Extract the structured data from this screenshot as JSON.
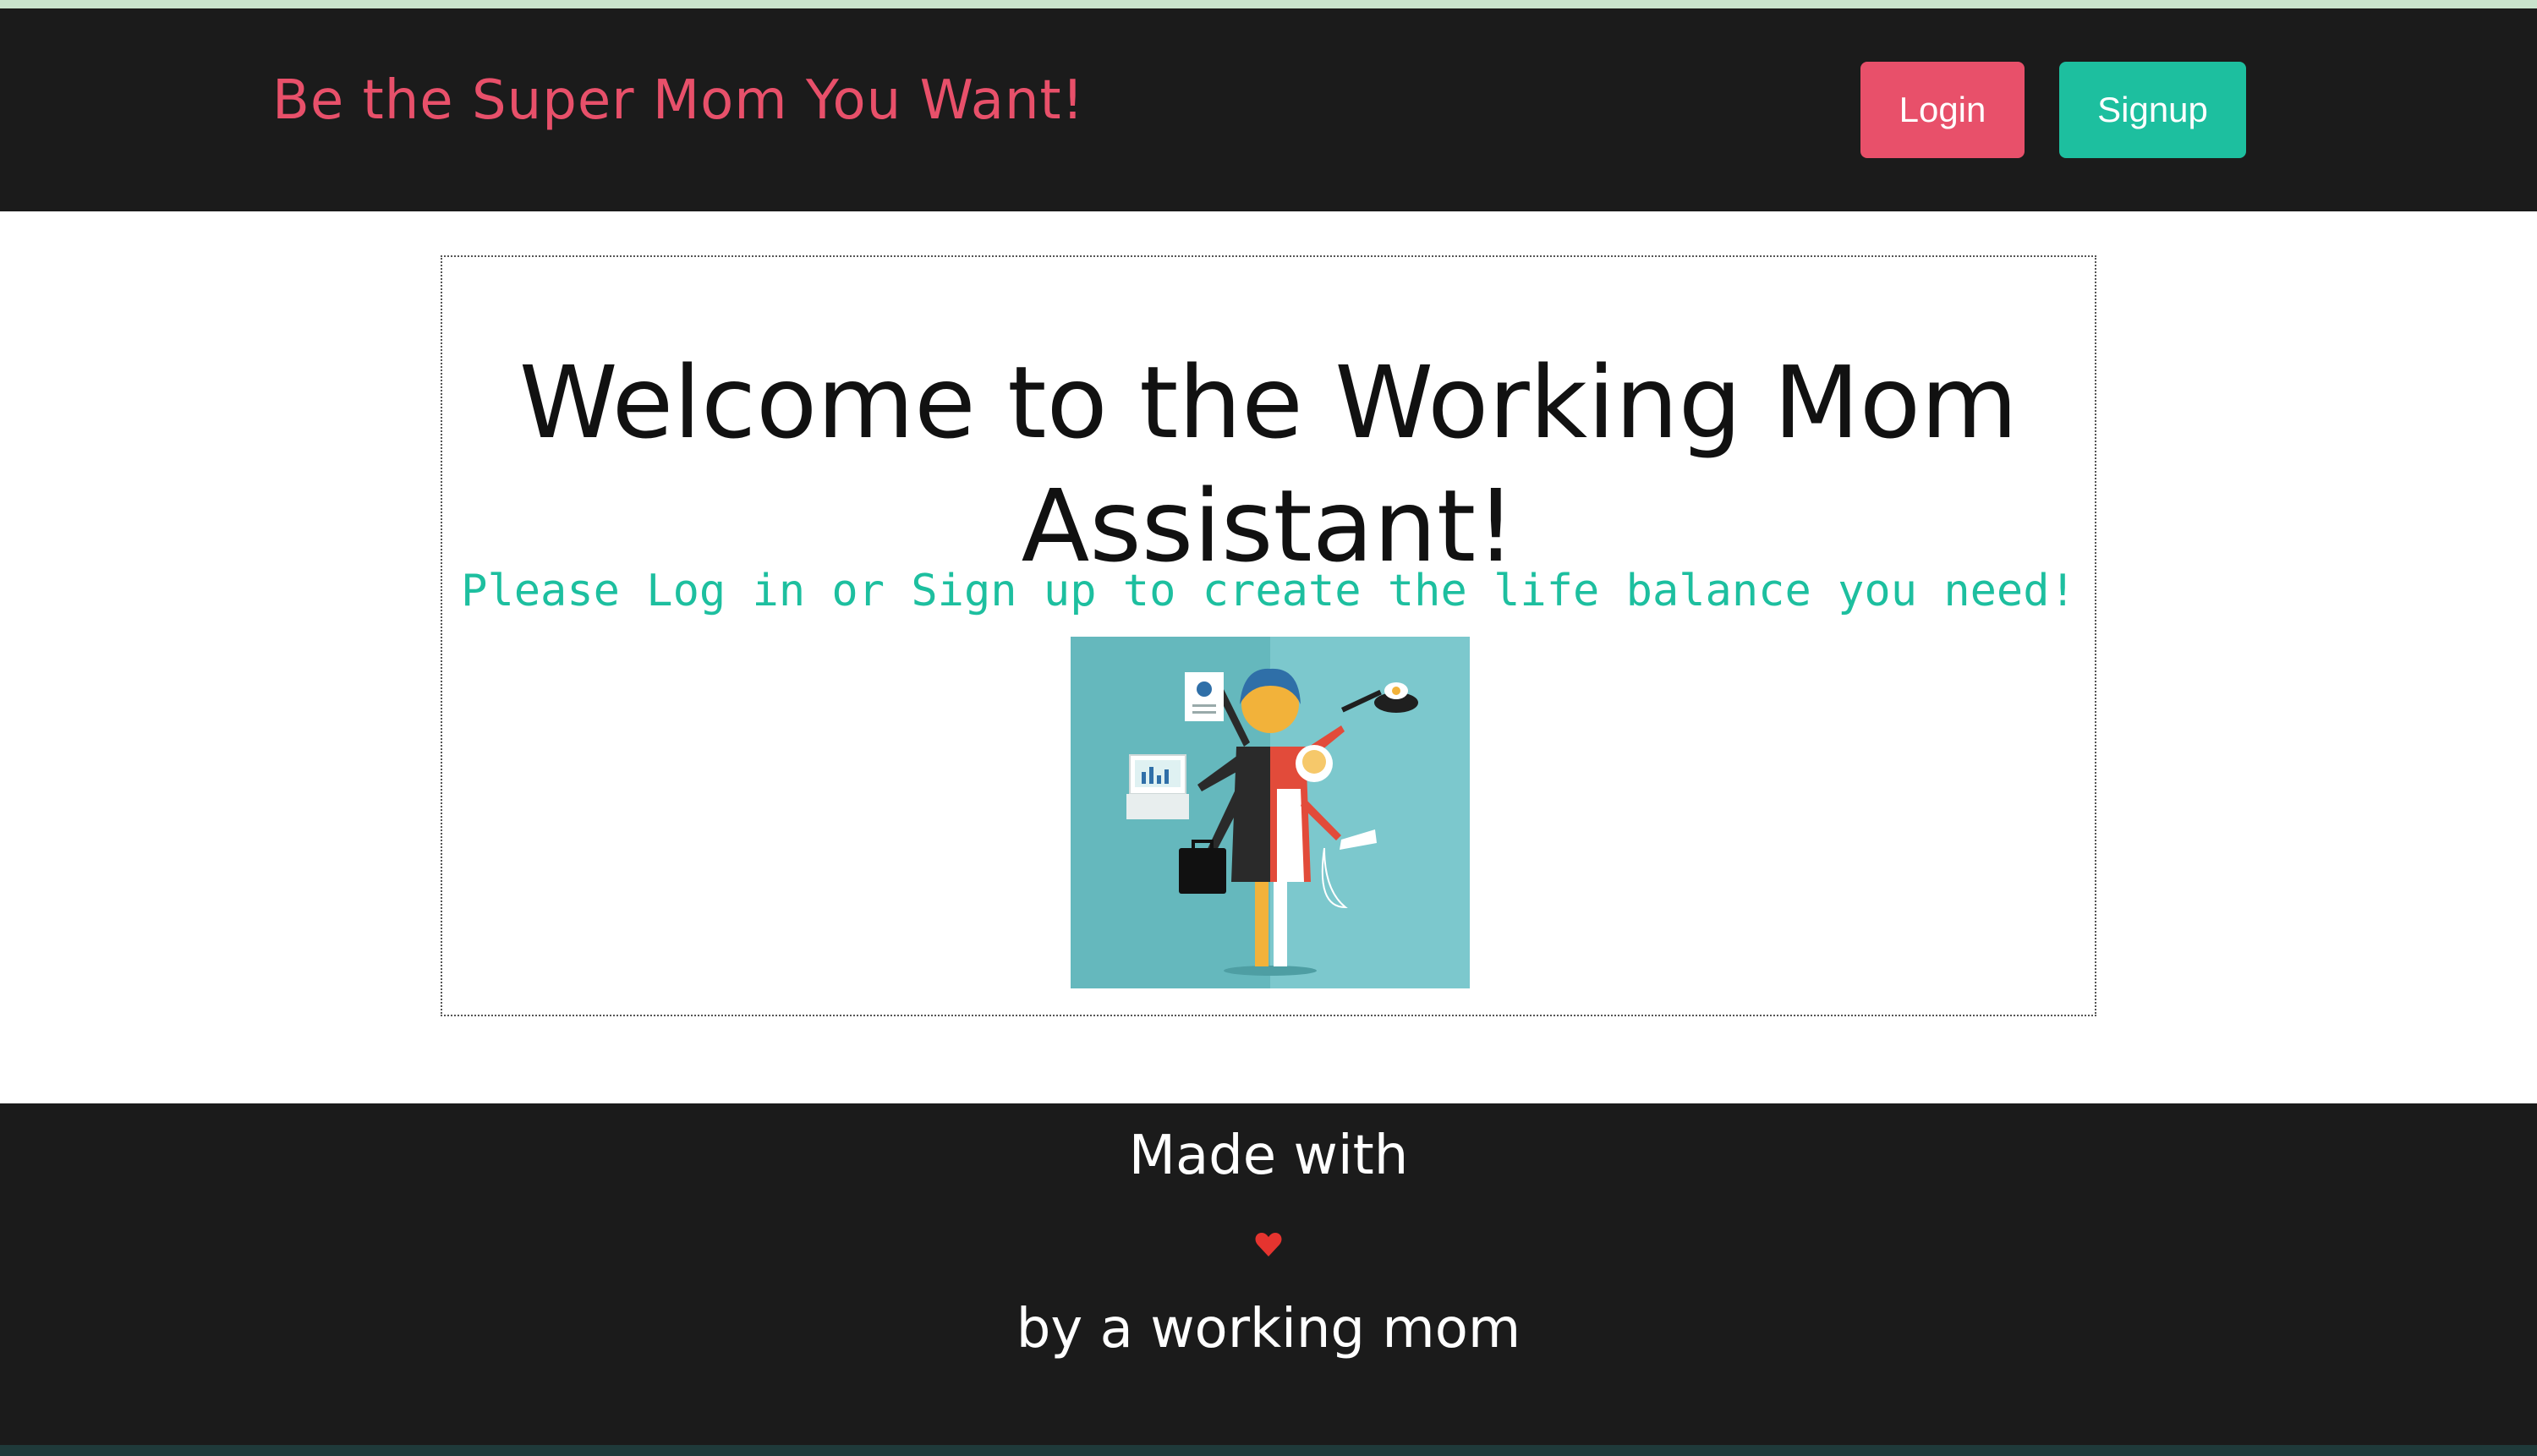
{
  "header": {
    "brand": "Be the Super Mom You Want!",
    "login_label": "Login",
    "signup_label": "Signup"
  },
  "main": {
    "welcome_title": "Welcome to the Working Mom Assistant!",
    "subtitle": "Please Log in or Sign up to create the life balance you need!",
    "illustration": "working-mom-multitasking-illustration"
  },
  "footer": {
    "made_with": "Made with",
    "heart_icon": "heart-icon",
    "by_line": "by a working mom"
  },
  "colors": {
    "accent_pink": "#e8506a",
    "accent_teal": "#1dbf9f",
    "dark_bg": "#1b1b1b",
    "heart_red": "#e5342f"
  }
}
